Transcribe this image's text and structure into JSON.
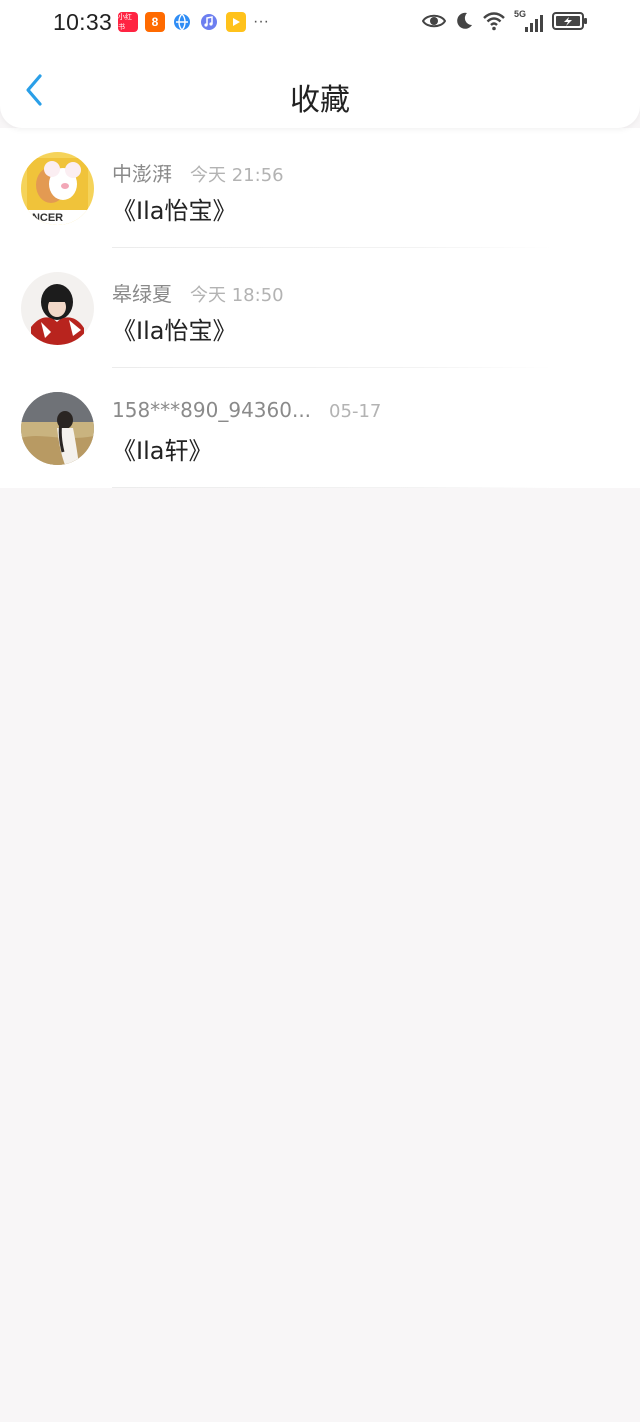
{
  "status_bar": {
    "time": "10:33",
    "notification_icons": [
      "xiaohongshu-icon",
      "kuaishou-icon",
      "browser-icon",
      "music-icon",
      "video-icon",
      "more-icon"
    ],
    "xhs_label": "小红书",
    "kuai_label": "8",
    "more_label": "···",
    "network_label": "5G"
  },
  "nav": {
    "title": "收藏"
  },
  "favorites": [
    {
      "name": "中澎湃",
      "time": "今天 21:56",
      "content": "《Ila怡宝》",
      "avatar_text": "ANCER"
    },
    {
      "name": "皋绿夏",
      "time": "今天 18:50",
      "content": "《Ila怡宝》"
    },
    {
      "name": "158***890_94360...",
      "time": "05-17",
      "content": "《Ila轩》"
    }
  ],
  "colors": {
    "accent": "#2a9fe8",
    "background": "#f8f6f7",
    "name_text": "#8a8a8a",
    "time_text": "#b3b3b3",
    "content_text": "#222222"
  }
}
